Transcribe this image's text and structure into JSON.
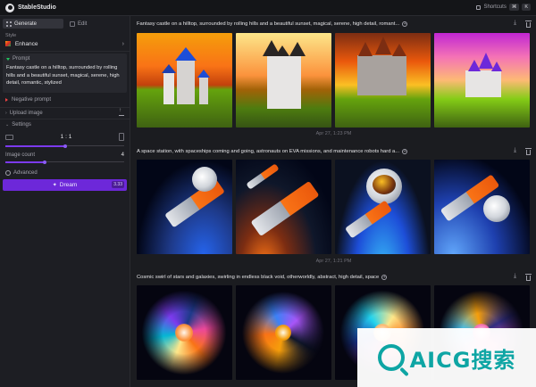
{
  "topbar": {
    "brand": "StableStudio",
    "shortcuts_label": "Shortcuts",
    "kbd_key": "K"
  },
  "sidebar": {
    "tabs": [
      {
        "label": "Generate",
        "active": true
      },
      {
        "label": "Edit",
        "active": false
      }
    ],
    "style_label": "Style",
    "style_value": "Enhance",
    "prompt_label": "Prompt",
    "prompt_text": "Fantasy castle on a hilltop, surrounded by rolling hills and a beautiful sunset, magical, serene, high detail, romantic, stylized",
    "negative_prompt_label": "Negative prompt",
    "upload_image_label": "Upload image",
    "settings_label": "Settings",
    "aspect_ratio": "1 : 1",
    "aspect_slider_level": 0.5,
    "image_count_label": "Image count",
    "image_count_value": "4",
    "image_count_slider_level": 0.33,
    "advanced_label": "Advanced",
    "dream_label": "Dream",
    "dream_cost": "3.33"
  },
  "main": {
    "groups": [
      {
        "prompt": "Fantasy castle on a hilltop, surrounded by rolling hills and a beautiful sunset, magical, serene, high detail, romant...",
        "theme": "castle",
        "date": "Apr 27, 1:23 PM"
      },
      {
        "prompt": "A space station, with spaceships coming and going, astronauts on EVA missions, and maintenance robots hard a...",
        "theme": "space",
        "date": "Apr 27, 1:21 PM"
      },
      {
        "prompt": "Cosmic swirl of stars and galaxies, swirling in endless black void, otherworldly, abstract, high detail, space",
        "theme": "galaxy",
        "date": ""
      }
    ]
  },
  "watermark": {
    "text": "AICG搜索"
  },
  "colors": {
    "accent": "#6d28d9",
    "background": "#1b1c20",
    "sidebar": "#1d1e23",
    "watermark": "#0ea5a4"
  },
  "icons": [
    "logo-icon",
    "keyboard-icon",
    "grid-icon",
    "edit-icon",
    "style-thumbnail-icon",
    "chevron-right-icon",
    "prompt-triangle-icon",
    "negative-triangle-icon",
    "upload-icon",
    "landscape-icon",
    "portrait-icon",
    "advanced-icon",
    "sparkle-icon",
    "add-circle-icon",
    "download-icon",
    "trash-icon",
    "search-icon"
  ]
}
